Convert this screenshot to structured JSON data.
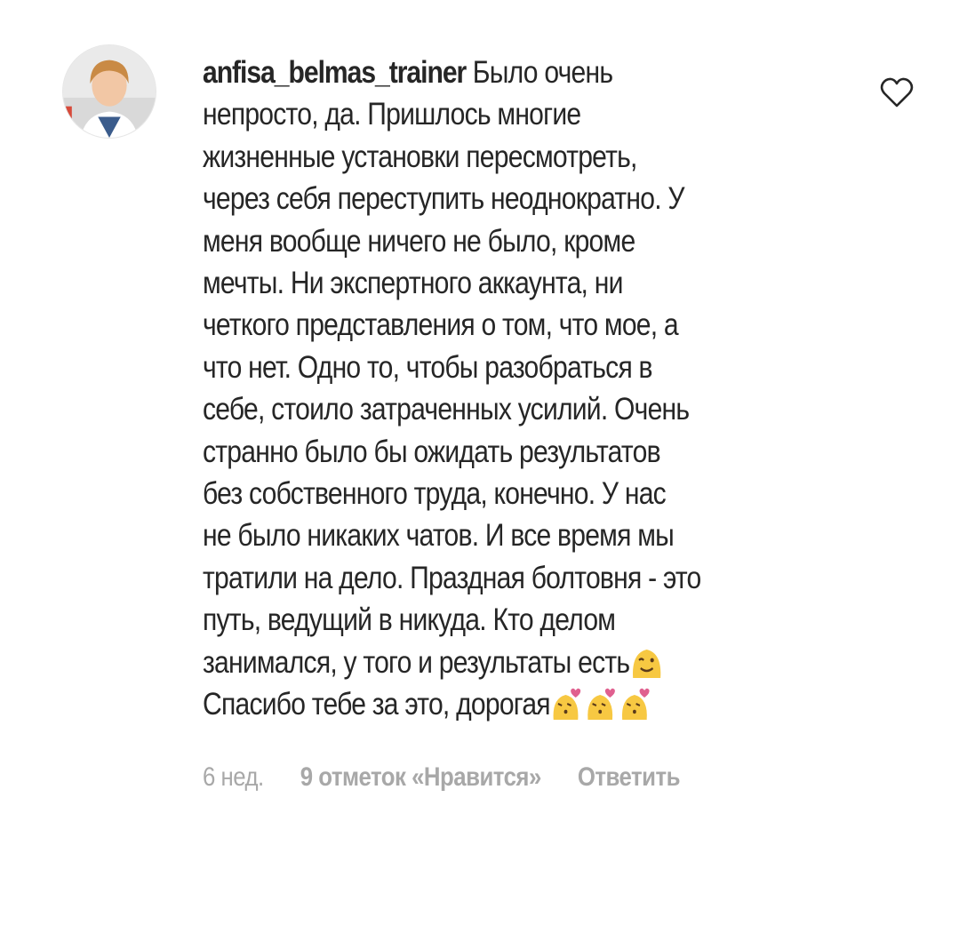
{
  "comment": {
    "username": "anfisa_belmas_trainer",
    "text_lines": [
      "Было очень",
      "непросто, да. Пришлось многие",
      "жизненные установки пересмотреть,",
      "через себя переступить неоднократно. У",
      "меня вообще ничего не было, кроме",
      "мечты. Ни экспертного аккаунта, ни",
      "четкого представления о том, что мое, а",
      "что нет. Одно то, чтобы разобраться в",
      "себе, стоило затраченных усилий. Очень",
      "странно было бы ожидать результатов",
      "без собственного труда, конечно. У нас",
      "не было никаких чатов. И все время мы",
      "тратили на дело. Праздная болтовня - это",
      "путь, ведущий в никуда. Кто делом",
      "занимался, у того и результаты есть",
      "Спасибо тебе за это, дорогая"
    ],
    "emojis": {
      "wink": "winking-face-emoji",
      "kiss": "kissing-face-with-heart-emoji",
      "kiss_count": 3
    },
    "time": "6 нед.",
    "likes": "9 отметок «Нравится»",
    "reply": "Ответить"
  },
  "icons": {
    "like": "heart-outline-icon"
  },
  "colors": {
    "text": "#262626",
    "meta": "#a8a8a8",
    "emoji": "#f7c842",
    "heart": "#e0608f"
  }
}
